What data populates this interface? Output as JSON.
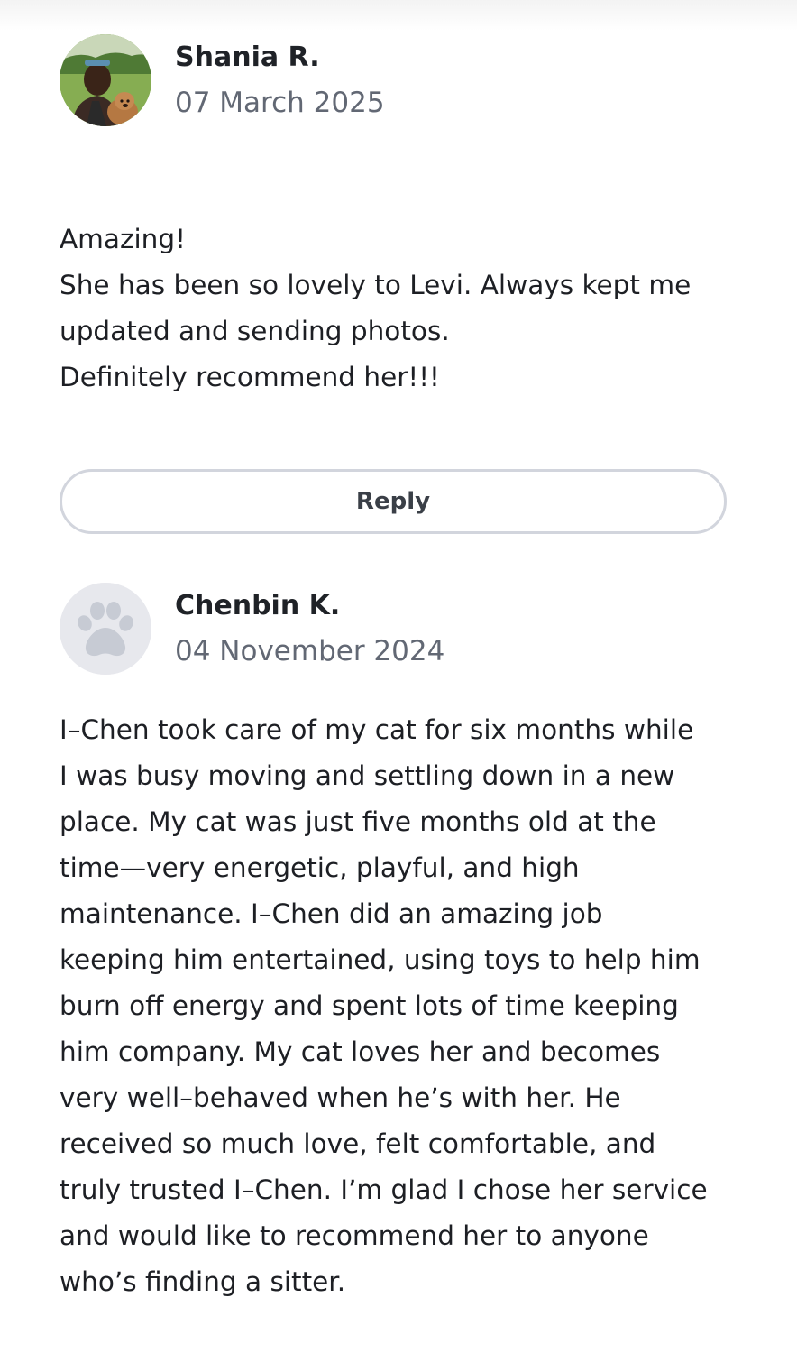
{
  "reviews": [
    {
      "author": "Shania R.",
      "date": "07 March 2025",
      "avatar": "user-photo",
      "body": [
        "Amazing!",
        "She has been so lovely to Levi. Always kept me",
        "updated and sending photos.",
        "Definitely recommend her!!!"
      ],
      "reply_label": "Reply"
    },
    {
      "author": "Chenbin K.",
      "date": "04 November 2024",
      "avatar": "paw-icon",
      "body": [
        "I–Chen took care of my cat for six months while",
        "I was busy moving and settling down in a new",
        "place. My cat was just five months old at the",
        "time—very energetic, playful, and high",
        "maintenance. I–Chen did an amazing job",
        "keeping him entertained, using toys to help him",
        "burn off energy and spent lots of time keeping",
        "him company. My cat loves her and becomes",
        "very well–behaved when he’s with her. He",
        "received so much love, felt comfortable, and",
        "truly trusted I–Chen. I’m glad I chose her service",
        "and would like to recommend her to anyone",
        "who’s finding a sitter."
      ]
    }
  ],
  "colors": {
    "text": "#1d1f24",
    "date": "#626874",
    "button_border": "#d2d5dd",
    "paw_bg": "#e7e8ed",
    "paw": "#c7cbd4"
  }
}
